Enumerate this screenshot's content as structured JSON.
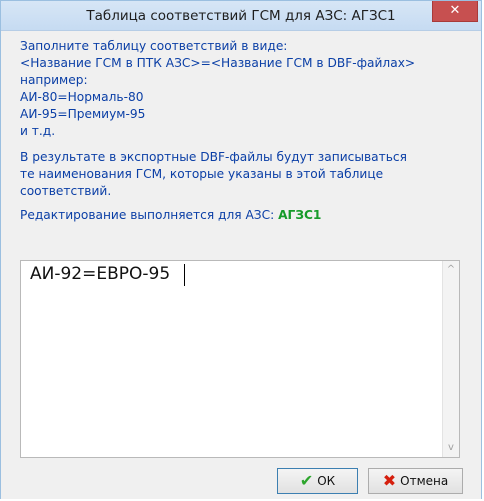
{
  "window": {
    "title": "Таблица соответствий ГСМ для АЗС: АГЗС1",
    "close_glyph": "✕"
  },
  "instructions": {
    "line1": "Заполните таблицу соответствий в виде:",
    "line2": "<Название ГСМ в ПТК АЗС>=<Название ГСМ в DBF-файлах>",
    "line3": "например:",
    "line4": "АИ-80=Нормаль-80",
    "line5": "АИ-95=Премиум-95",
    "line6": "и т.д.",
    "line7": "В результате в экспортные DBF-файлы будут записываться",
    "line8": "те наименования ГСМ, которые указаны в этой таблице",
    "line9": "соответствий.",
    "editing_prefix": "Редактирование выполняется для АЗС: ",
    "editing_station": "АГЗС1"
  },
  "editor": {
    "value": "АИ-92=ЕВРО-95",
    "scroll_up_glyph": "^",
    "scroll_down_glyph": "v"
  },
  "buttons": {
    "ok_label": "ОК",
    "ok_icon": "✔",
    "cancel_label": "Отмена",
    "cancel_icon": "✖"
  },
  "colors": {
    "text": "#0b3fa6",
    "station": "#169b2a",
    "close_button": "#c75050"
  }
}
